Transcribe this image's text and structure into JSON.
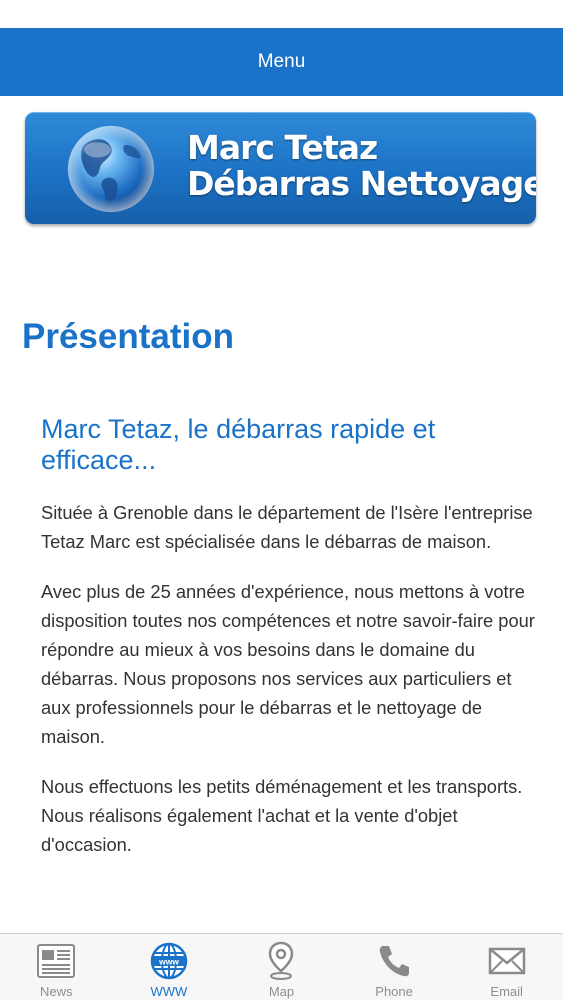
{
  "header": {
    "menu_label": "Menu"
  },
  "banner": {
    "line1": "Marc Tetaz",
    "line2": "Débarras Nettoyage",
    "logo_icon": "globe-icon"
  },
  "main": {
    "title": "Présentation",
    "subtitle": "Marc Tetaz, le débarras rapide et efficace...",
    "paragraphs": [
      "Située à Grenoble dans le département de l'Isère l'entreprise Tetaz Marc est spécialisée dans le débarras de maison.",
      "Avec plus de 25 années d'expérience, nous mettons à votre disposition toutes nos compétences et notre savoir-faire pour répondre au mieux à vos besoins dans le domaine du débarras. Nous proposons nos services aux particuliers et aux professionnels pour le débarras et le nettoyage de maison.",
      "Nous effectuons les petits déménagement et les transports. Nous réalisons également l'achat et la vente d'objet d'occasion."
    ]
  },
  "tabbar": {
    "active_tab": "WWW",
    "tabs": [
      {
        "label": "News",
        "icon": "newspaper-icon"
      },
      {
        "label": "WWW",
        "icon": "web-globe-icon"
      },
      {
        "label": "Map",
        "icon": "map-pin-icon"
      },
      {
        "label": "Phone",
        "icon": "phone-icon"
      },
      {
        "label": "Email",
        "icon": "envelope-icon"
      }
    ]
  },
  "colors": {
    "accent": "#1a73c9",
    "text": "#333333",
    "tab_inactive": "#8e8e8e",
    "tab_bar_bg": "#f7f7f7"
  }
}
